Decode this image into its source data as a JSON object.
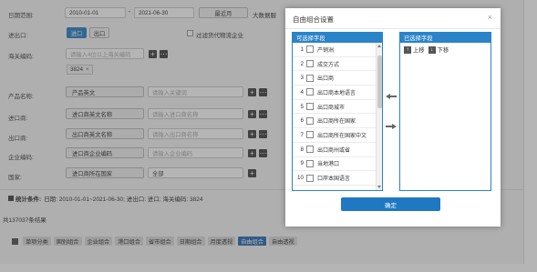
{
  "filters": {
    "date_range_label": "日期范围:",
    "date_start": "2010-01-01",
    "date_end": "2021-06-30",
    "recent_button": "最近月",
    "big_data_text": "大数据服",
    "direction_label": "进出口:",
    "import_btn": "进口",
    "export_btn": "出口",
    "filter_check_label": "过滤货代物流企业",
    "hscode_label": "海关编码:",
    "hscode_placeholder": "请输入4位以上海关编码",
    "hscode_tag": "3824",
    "product_label": "产品名称:",
    "product_select": "产品英文",
    "product_placeholder": "请输入关键词",
    "importer_label": "进口商:",
    "importer_select": "进口商英文名称",
    "importer_placeholder": "请输入进口商名称",
    "exporter_label": "出口商:",
    "exporter_select": "出口商英文名称",
    "exporter_placeholder": "请输入出口商名称",
    "company_code_label": "企业编码:",
    "company_code_select": "进口商企业编码",
    "company_code_placeholder": "请输入企业编码",
    "country_label": "国家:",
    "country_select": "进口商所在国家",
    "country_value": "全部"
  },
  "stats": {
    "title": "统计条件:",
    "text": "日期: 2010-01-01~2021-06-30; 进出口: 进口; 海关编码: 3824",
    "result_count": "共137037条结果"
  },
  "tabs": [
    "单项分类",
    "国别组合",
    "企业组合",
    "港口组合",
    "省市组合",
    "日期组合",
    "月度透视",
    "自由组合",
    "自由透视"
  ],
  "active_tab": "自由组合",
  "modal": {
    "title": "自由组合设置",
    "close": "×",
    "left_panel_title": "可选择字段",
    "right_panel_title": "已选择字段",
    "move_up": "上移",
    "move_down": "下移",
    "confirm": "确定",
    "fields": [
      {
        "num": "1",
        "label": "产销洲"
      },
      {
        "num": "2",
        "label": "成交方式"
      },
      {
        "num": "3",
        "label": "出口商"
      },
      {
        "num": "4",
        "label": "出口商本地语言"
      },
      {
        "num": "5",
        "label": "出口商城市"
      },
      {
        "num": "6",
        "label": "出口商所在国家"
      },
      {
        "num": "7",
        "label": "出口商所在国家中文"
      },
      {
        "num": "8",
        "label": "出口商州或省"
      },
      {
        "num": "9",
        "label": "当地港口"
      },
      {
        "num": "10",
        "label": "口岸本国语言"
      }
    ]
  },
  "colors": {
    "accent": "#2b83c8",
    "confirm": "#1e78c2",
    "overlay": "rgba(60,60,60,0.38)"
  }
}
